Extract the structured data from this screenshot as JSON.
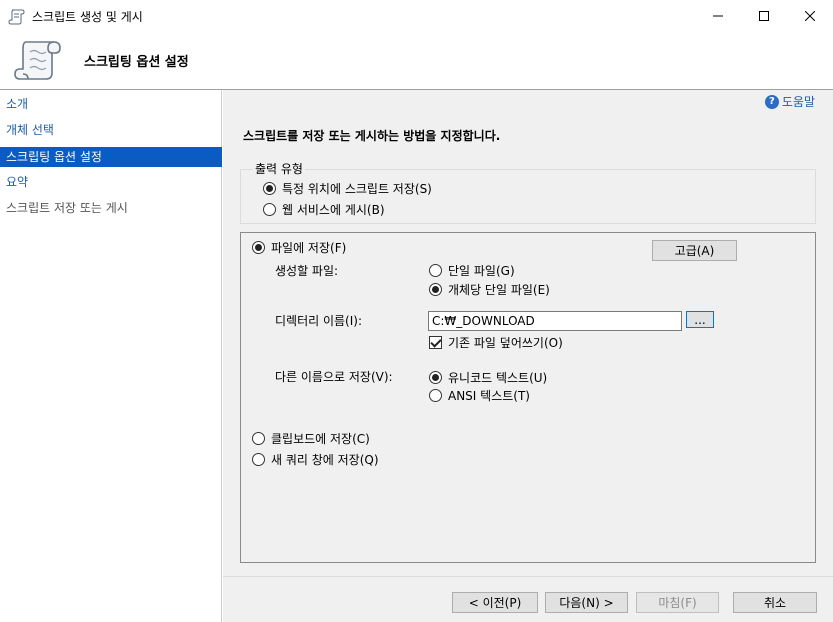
{
  "window": {
    "title": "스크립트 생성 및 게시",
    "icon": "script-scroll-icon"
  },
  "header": {
    "heading": "스크립팅 옵션 설정"
  },
  "sidebar": {
    "items": [
      {
        "label": "소개",
        "state": "link"
      },
      {
        "label": "개체 선택",
        "state": "link"
      },
      {
        "label": "스크립팅 옵션 설정",
        "state": "active"
      },
      {
        "label": "요약",
        "state": "link"
      },
      {
        "label": "스크립트 저장 또는 게시",
        "state": "disabled"
      }
    ]
  },
  "main": {
    "help_label": "도움말",
    "instruction": "스크립트를 저장 또는 게시하는 방법을 지정합니다.",
    "output_type": {
      "title": "출력 유형",
      "options": [
        {
          "label": "특정 위치에 스크립트 저장(S)",
          "checked": true
        },
        {
          "label": "웹 서비스에 게시(B)",
          "checked": false
        }
      ]
    },
    "save_options": {
      "save_to_file": {
        "label": "파일에 저장(F)",
        "checked": true
      },
      "advanced_button": "고급(A)",
      "files_to_generate": {
        "label": "생성할 파일:",
        "options": [
          {
            "label": "단일 파일(G)",
            "checked": false
          },
          {
            "label": "개체당 단일 파일(E)",
            "checked": true
          }
        ]
      },
      "directory": {
        "label": "디렉터리 이름(I):",
        "value": "C:₩_DOWNLOAD",
        "browse_label": "..."
      },
      "overwrite": {
        "label": "기존 파일 덮어쓰기(O)",
        "checked": true
      },
      "save_as": {
        "label": "다른 이름으로 저장(V):",
        "options": [
          {
            "label": "유니코드 텍스트(U)",
            "checked": true
          },
          {
            "label": "ANSI 텍스트(T)",
            "checked": false
          }
        ]
      },
      "save_to_clipboard": {
        "label": "클립보드에 저장(C)",
        "checked": false
      },
      "save_to_query_window": {
        "label": "새 쿼리 창에 저장(Q)",
        "checked": false
      }
    }
  },
  "footer": {
    "prev": "< 이전(P)",
    "next": "다음(N) >",
    "finish": "마침(F)",
    "cancel": "취소"
  }
}
